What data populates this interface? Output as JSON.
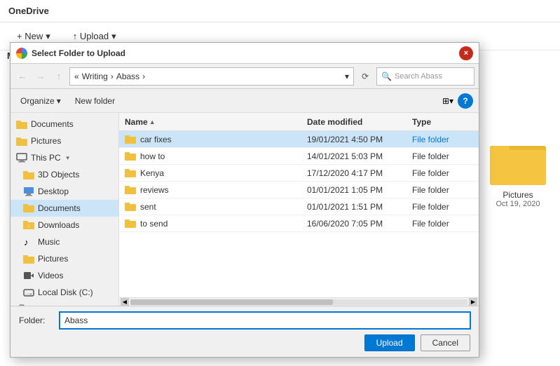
{
  "onedrive": {
    "title": "OneDrive",
    "toolbar": {
      "new_label": "+ New",
      "new_chevron": "▾",
      "upload_label": "↑ Upload",
      "upload_chevron": "▾"
    },
    "my_files": "My Files",
    "bg_folder": {
      "label": "Pictures",
      "date": "Oct 19, 2020"
    }
  },
  "dialog": {
    "title": "Select Folder to Upload",
    "close_label": "×",
    "address": {
      "back_disabled": true,
      "forward_disabled": true,
      "up_label": "↑",
      "breadcrumb": [
        "«",
        "Writing",
        ">",
        "Abass",
        ">"
      ],
      "writing": "Writing",
      "abass": "Abass",
      "search_placeholder": "Search Abass"
    },
    "toolbar": {
      "organize_label": "Organize",
      "organize_chevron": "▾",
      "new_folder_label": "New folder",
      "view_icon": "⊞",
      "view_chevron": "▾",
      "help_label": "?"
    },
    "sidebar": {
      "items": [
        {
          "label": "Documents",
          "type": "folder",
          "indent": 0
        },
        {
          "label": "Pictures",
          "type": "folder",
          "indent": 0
        },
        {
          "label": "This PC",
          "type": "pc",
          "indent": 0,
          "expanded": true
        },
        {
          "label": "3D Objects",
          "type": "folder3d",
          "indent": 1
        },
        {
          "label": "Desktop",
          "type": "desktop",
          "indent": 1
        },
        {
          "label": "Documents",
          "type": "docs",
          "indent": 1,
          "selected": true
        },
        {
          "label": "Downloads",
          "type": "download",
          "indent": 1
        },
        {
          "label": "Music",
          "type": "music",
          "indent": 1
        },
        {
          "label": "Pictures",
          "type": "pictures",
          "indent": 1
        },
        {
          "label": "Videos",
          "type": "video",
          "indent": 1
        },
        {
          "label": "Local Disk (C:)",
          "type": "disk",
          "indent": 1
        },
        {
          "label": "Network",
          "type": "network",
          "indent": 0
        }
      ]
    },
    "columns": {
      "name": "Name",
      "date_modified": "Date modified",
      "type": "Type"
    },
    "files": [
      {
        "name": "car fixes",
        "date": "19/01/2021 4:50 PM",
        "type": "File folder",
        "selected": true
      },
      {
        "name": "how to",
        "date": "14/01/2021 5:03 PM",
        "type": "File folder"
      },
      {
        "name": "Kenya",
        "date": "17/12/2020 4:17 PM",
        "type": "File folder"
      },
      {
        "name": "reviews",
        "date": "01/01/2021 1:05 PM",
        "type": "File folder"
      },
      {
        "name": "sent",
        "date": "01/01/2021 1:51 PM",
        "type": "File folder"
      },
      {
        "name": "to send",
        "date": "16/06/2020 7:05 PM",
        "type": "File folder"
      }
    ],
    "folder_label": "Folder:",
    "folder_value": "Abass",
    "upload_button": "Upload",
    "cancel_button": "Cancel"
  }
}
